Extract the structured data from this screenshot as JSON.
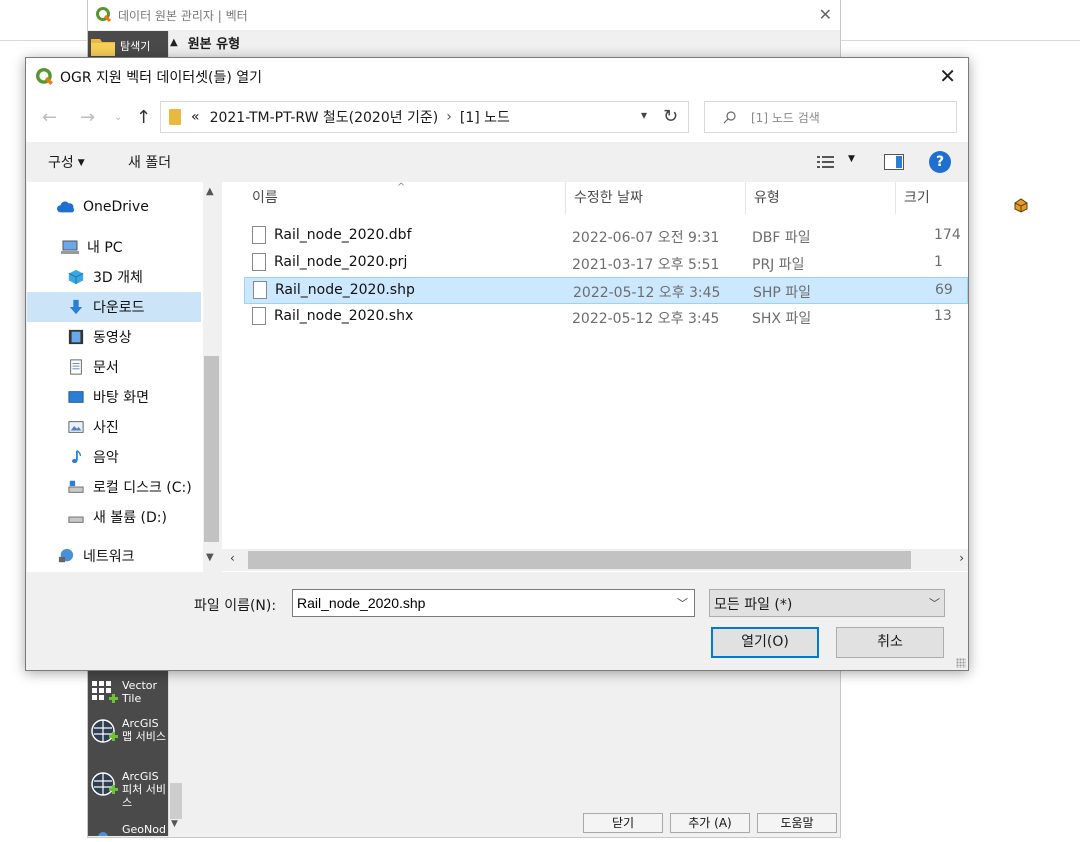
{
  "background_window": {
    "title": "데이터 원본 관리자 | 벡터",
    "explorer_label": "탐색기",
    "section_header": "원본 유형",
    "sidebar_items": [
      {
        "label": "Vector Tile",
        "icon": "vector-tile-icon"
      },
      {
        "label": "ArcGIS 맵 서비스",
        "icon": "arcgis-globe-icon"
      },
      {
        "label": "ArcGIS 피처 서비스",
        "icon": "arcgis-globe-icon"
      },
      {
        "label": "GeoNod",
        "icon": "geonode-icon"
      }
    ],
    "buttons": {
      "close": "닫기",
      "add": "추가 (A)",
      "help": "도움말"
    }
  },
  "dialog": {
    "title": "OGR 지원 벡터 데이터셋(들) 열기",
    "address": {
      "overflow": "«",
      "crumbs": [
        "2021-TM-PT-RW 철도(2020년 기준)",
        "[1] 노드"
      ]
    },
    "search_placeholder": "[1] 노드 검색",
    "toolbar": {
      "organize": "구성",
      "new_folder": "새 폴더"
    },
    "nav_items": [
      {
        "label": "OneDrive",
        "icon": "onedrive-cloud-icon"
      },
      {
        "label": "내 PC",
        "icon": "pc-icon"
      },
      {
        "label": "3D 개체",
        "icon": "3d-objects-icon"
      },
      {
        "label": "다운로드",
        "icon": "download-icon",
        "selected": true
      },
      {
        "label": "동영상",
        "icon": "video-icon"
      },
      {
        "label": "문서",
        "icon": "document-icon"
      },
      {
        "label": "바탕 화면",
        "icon": "desktop-icon"
      },
      {
        "label": "사진",
        "icon": "picture-icon"
      },
      {
        "label": "음악",
        "icon": "music-icon"
      },
      {
        "label": "로컬 디스크 (C:)",
        "icon": "drive-c-icon"
      },
      {
        "label": "새 볼륨 (D:)",
        "icon": "drive-d-icon"
      },
      {
        "label": "네트워크",
        "icon": "network-icon"
      }
    ],
    "columns": [
      "이름",
      "수정한 날짜",
      "유형",
      "크기"
    ],
    "files": [
      {
        "name": "Rail_node_2020.dbf",
        "date": "2022-06-07 오전 9:31",
        "type": "DBF 파일",
        "size": "174"
      },
      {
        "name": "Rail_node_2020.prj",
        "date": "2021-03-17 오후 5:51",
        "type": "PRJ 파일",
        "size": "1"
      },
      {
        "name": "Rail_node_2020.shp",
        "date": "2022-05-12 오후 3:45",
        "type": "SHP 파일",
        "size": "69",
        "selected": true
      },
      {
        "name": "Rail_node_2020.shx",
        "date": "2022-05-12 오후 3:45",
        "type": "SHX 파일",
        "size": "13"
      }
    ],
    "filename_label": "파일 이름(N):",
    "filename_value": "Rail_node_2020.shp",
    "filter_value": "모든 파일 (*)",
    "open_button": "열기(O)",
    "cancel_button": "취소"
  },
  "colors": {
    "accent": "#0078d7",
    "selection": "#cce8ff",
    "qgis_green": "#589632"
  }
}
